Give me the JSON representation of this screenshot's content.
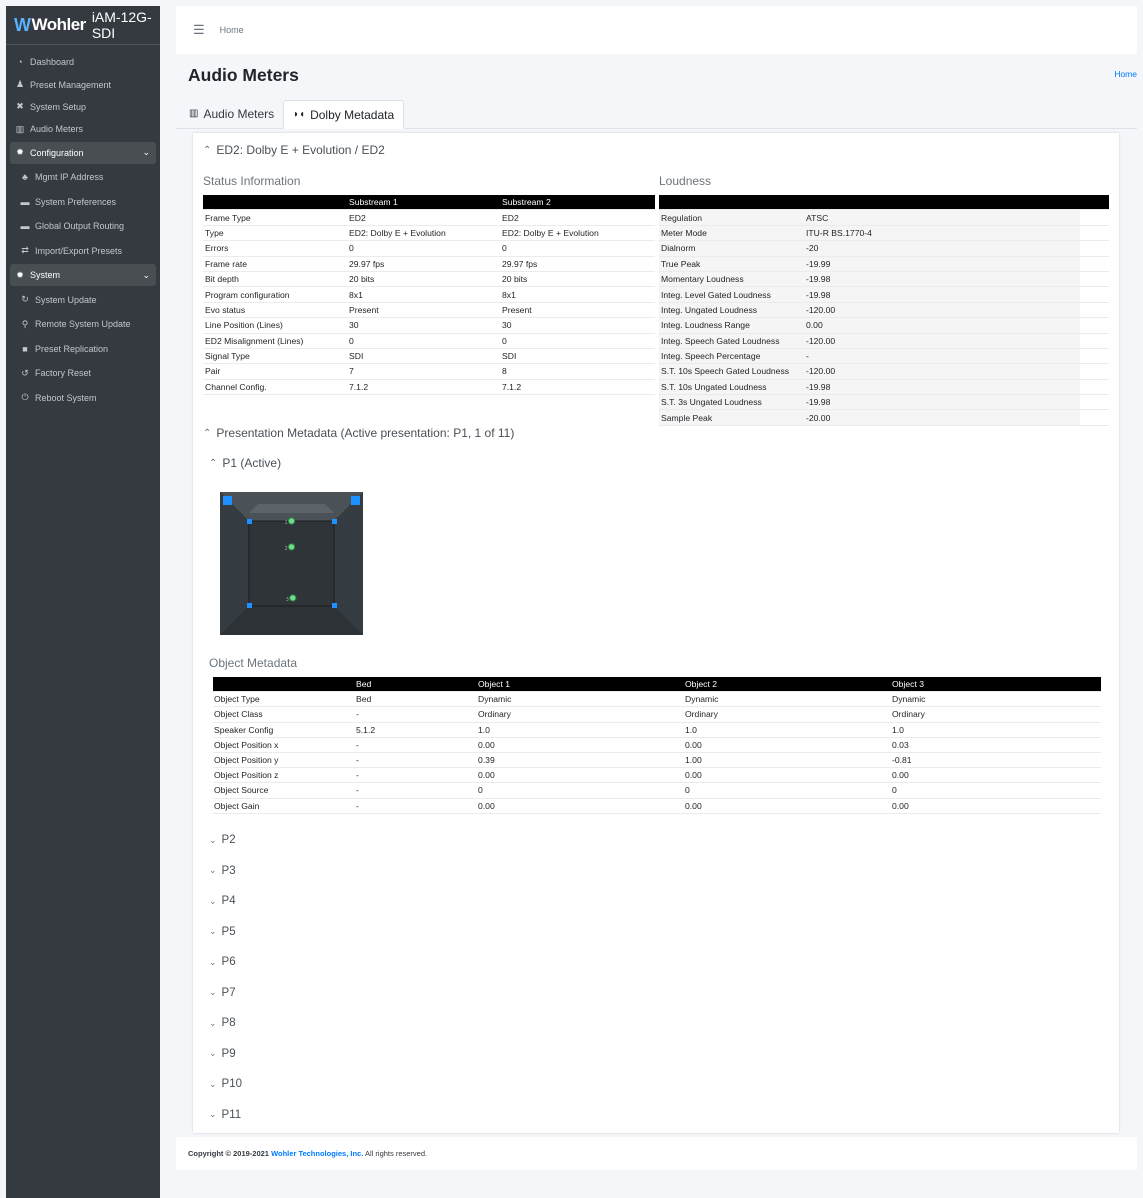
{
  "brand": {
    "logo": "Wohler",
    "name": "iAM-12G-SDI"
  },
  "sidebar": {
    "items": [
      {
        "label": "Dashboard",
        "icon": "dashboard-icon",
        "glyph": "◔"
      },
      {
        "label": "Preset Management",
        "icon": "preset-user-icon",
        "glyph": "♟"
      },
      {
        "label": "System Setup",
        "icon": "tools-icon",
        "glyph": "✖"
      },
      {
        "label": "Audio Meters",
        "icon": "chart-icon",
        "glyph": "▥"
      }
    ],
    "configuration": {
      "label": "Configuration",
      "glyph": "✹",
      "items": [
        {
          "label": "Mgmt IP Address",
          "icon": "network-icon",
          "glyph": "♣"
        },
        {
          "label": "System Preferences",
          "icon": "keyboard-icon",
          "glyph": "▬"
        },
        {
          "label": "Global Output Routing",
          "icon": "keyboard-icon",
          "glyph": "▬"
        },
        {
          "label": "Import/Export Presets",
          "icon": "exchange-icon",
          "glyph": "⇄"
        }
      ]
    },
    "system": {
      "label": "System",
      "glyph": "✹",
      "items": [
        {
          "label": "System Update",
          "icon": "sync-icon",
          "glyph": "↻"
        },
        {
          "label": "Remote System Update",
          "icon": "satellite-icon",
          "glyph": "⚲"
        },
        {
          "label": "Preset Replication",
          "icon": "copy-icon",
          "glyph": "■"
        },
        {
          "label": "Factory Reset",
          "icon": "undo-icon",
          "glyph": "↺"
        },
        {
          "label": "Reboot System",
          "icon": "power-icon",
          "glyph": "⏻"
        }
      ]
    }
  },
  "topbar": {
    "home": "Home"
  },
  "header": {
    "title": "Audio Meters",
    "breadcrumb": "Home"
  },
  "tabs": [
    {
      "label": "Audio Meters"
    },
    {
      "label": "Dolby Metadata"
    }
  ],
  "ed2": {
    "title": "ED2: Dolby E + Evolution / ED2",
    "status": {
      "title": "Status Information",
      "headers": [
        "",
        "Substream 1",
        "Substream 2"
      ],
      "rows": [
        [
          "Frame Type",
          "ED2",
          "ED2"
        ],
        [
          "Type",
          "ED2: Dolby E + Evolution",
          "ED2: Dolby E + Evolution"
        ],
        [
          "Errors",
          "0",
          "0"
        ],
        [
          "Frame rate",
          "29.97 fps",
          "29.97 fps"
        ],
        [
          "Bit depth",
          "20 bits",
          "20 bits"
        ],
        [
          "Program configuration",
          "8x1",
          "8x1"
        ],
        [
          "Evo status",
          "Present",
          "Present"
        ],
        [
          "Line Position (Lines)",
          "30",
          "30"
        ],
        [
          "ED2 Misalignment (Lines)",
          "0",
          "0"
        ],
        [
          "Signal Type",
          "SDI",
          "SDI"
        ],
        [
          "Pair",
          "7",
          "8"
        ],
        [
          "Channel Config.",
          "7.1.2",
          "7.1.2"
        ]
      ]
    },
    "loudness": {
      "title": "Loudness",
      "rows": [
        [
          "Regulation",
          "ATSC"
        ],
        [
          "Meter Mode",
          "ITU-R BS.1770-4"
        ],
        [
          "Dialnorm",
          "-20"
        ],
        [
          "True Peak",
          "-19.99"
        ],
        [
          "Momentary Loudness",
          "-19.98"
        ],
        [
          "Integ. Level Gated Loudness",
          "-19.98"
        ],
        [
          "Integ. Ungated Loudness",
          "-120.00"
        ],
        [
          "Integ. Loudness Range",
          "0.00"
        ],
        [
          "Integ. Speech Gated Loudness",
          "-120.00"
        ],
        [
          "Integ. Speech Percentage",
          "-"
        ],
        [
          "S.T. 10s Speech Gated Loudness",
          "-120.00"
        ],
        [
          "S.T. 10s Ungated Loudness",
          "-19.98"
        ],
        [
          "S.T. 3s Ungated Loudness",
          "-19.98"
        ],
        [
          "Sample Peak",
          "-20.00"
        ]
      ]
    }
  },
  "presentation": {
    "title": "Presentation Metadata (Active presentation: P1, 1 of 11)",
    "active": "P1 (Active)",
    "object_labels": [
      "2",
      "1",
      "3"
    ],
    "object_metadata": {
      "title": "Object Metadata",
      "headers": [
        "",
        "Bed",
        "Object 1",
        "Object 2",
        "Object 3"
      ],
      "rows": [
        [
          "Object Type",
          "Bed",
          "Dynamic",
          "Dynamic",
          "Dynamic"
        ],
        [
          "Object Class",
          "-",
          "Ordinary",
          "Ordinary",
          "Ordinary"
        ],
        [
          "Speaker Config",
          "5.1.2",
          "1.0",
          "1.0",
          "1.0"
        ],
        [
          "Object Position x",
          "-",
          "0.00",
          "0.00",
          "0.03"
        ],
        [
          "Object Position y",
          "-",
          "0.39",
          "1.00",
          "-0.81"
        ],
        [
          "Object Position z",
          "-",
          "0.00",
          "0.00",
          "0.00"
        ],
        [
          "Object Source",
          "-",
          "0",
          "0",
          "0"
        ],
        [
          "Object Gain",
          "-",
          "0.00",
          "0.00",
          "0.00"
        ]
      ]
    },
    "collapsed": [
      "P2",
      "P3",
      "P4",
      "P5",
      "P6",
      "P7",
      "P8",
      "P9",
      "P10",
      "P11"
    ]
  },
  "footer": {
    "prefix": "Copyright © 2019-2021",
    "company": "Wohler Technologies, Inc.",
    "suffix": "All rights reserved."
  },
  "colors": {
    "sidebar": "#343a40",
    "link": "#007bff",
    "table_header": "#000000",
    "object_dot": "#6fdc8c",
    "corner_marker": "#1e90ff"
  }
}
